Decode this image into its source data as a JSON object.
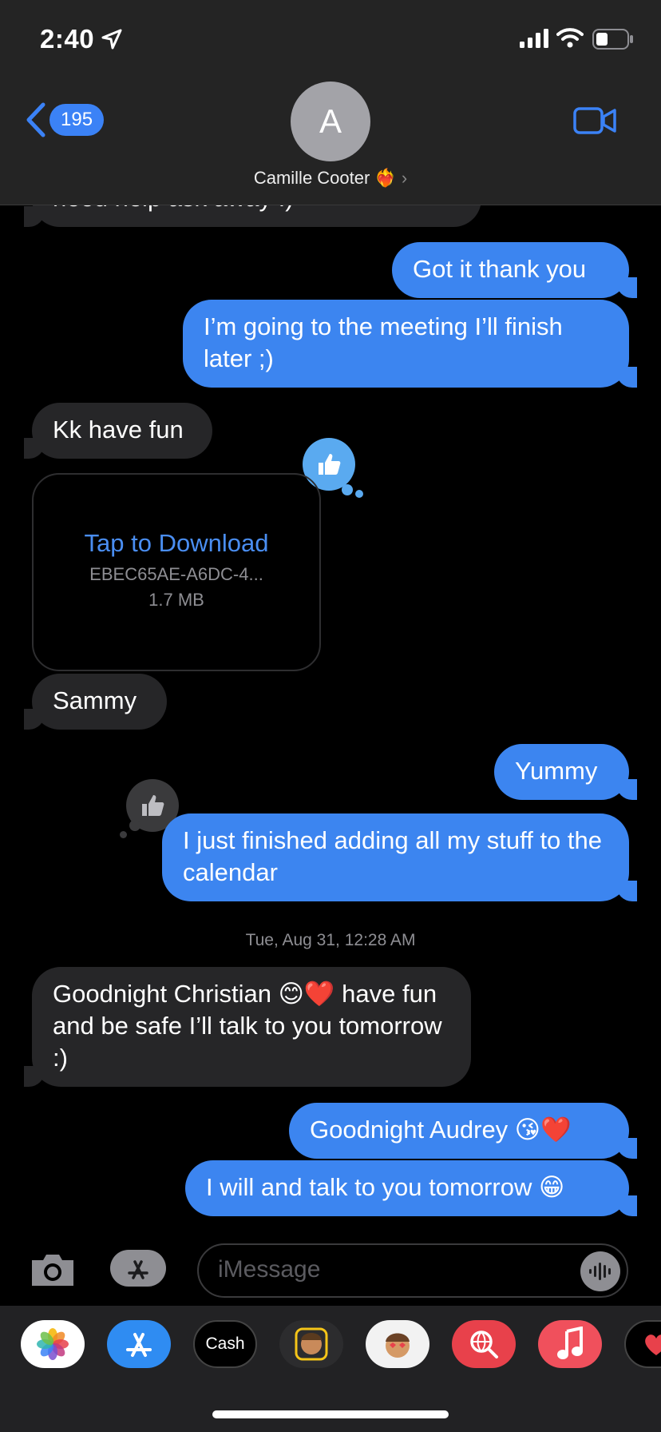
{
  "status_bar": {
    "time": "2:40"
  },
  "nav": {
    "back_count": "195",
    "avatar_initial": "A",
    "contact_name": "Camille Cooter ❤️‍🔥",
    "chevron": "›"
  },
  "messages": [
    {
      "dir": "in",
      "text": "need help ask away :)"
    },
    {
      "dir": "out",
      "text": "Got it thank you"
    },
    {
      "dir": "out",
      "text": "I’m going to the meeting I’ll finish later ;)"
    },
    {
      "dir": "in",
      "text": "Kk have fun"
    },
    {
      "dir": "in",
      "text": "Sammy"
    },
    {
      "dir": "out",
      "text": "Yummy"
    },
    {
      "dir": "out",
      "text": "I just finished adding all my stuff to the calendar"
    },
    {
      "dir": "in",
      "text": "Goodnight Christian 😊❤️  have fun and be safe I’ll talk to you tomorrow :)"
    },
    {
      "dir": "out",
      "text": "Goodnight Audrey 😘❤️"
    },
    {
      "dir": "out",
      "text": "I will and talk to you tomorrow 😁"
    }
  ],
  "attachment": {
    "action": "Tap to Download",
    "filename": "EBEC65AE-A6DC-4...",
    "size": "1.7 MB"
  },
  "timestamp": "Tue, Aug 31, 12:28 AM",
  "input": {
    "placeholder": "iMessage"
  },
  "app_drawer": {
    "apps": [
      {
        "icon": "photos-icon"
      },
      {
        "icon": "app-store-icon"
      },
      {
        "icon": "apple-cash-icon",
        "label": "Cash"
      },
      {
        "icon": "memoji-icon"
      },
      {
        "icon": "memoji-stickers-icon"
      },
      {
        "icon": "web-search-icon"
      },
      {
        "icon": "music-icon"
      },
      {
        "icon": "digital-touch-icon"
      }
    ]
  },
  "colors": {
    "accent": "#3c85f0",
    "incoming": "#262628",
    "header": "#242424"
  }
}
